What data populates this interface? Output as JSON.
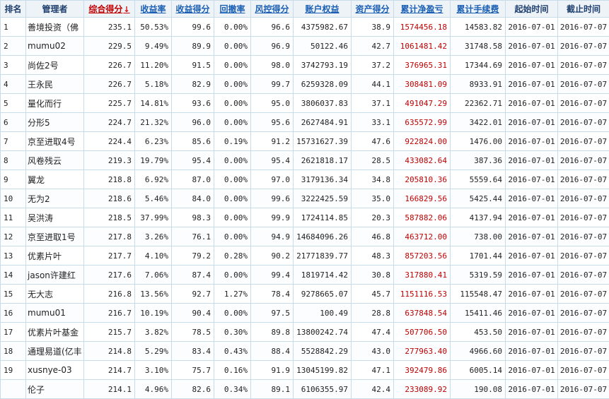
{
  "headers": [
    {
      "label": "排名",
      "sortable": false
    },
    {
      "label": "管理者",
      "sortable": false
    },
    {
      "label": "综合得分",
      "sortable": true,
      "sorted": true,
      "sort_icon": "sort-desc-arrow",
      "sort_glyph": "↓"
    },
    {
      "label": "收益率",
      "sortable": true
    },
    {
      "label": "收益得分",
      "sortable": true
    },
    {
      "label": "回撤率",
      "sortable": true
    },
    {
      "label": "风控得分",
      "sortable": true
    },
    {
      "label": "账户权益",
      "sortable": true
    },
    {
      "label": "资产得分",
      "sortable": true
    },
    {
      "label": "累计净盈亏",
      "sortable": true
    },
    {
      "label": "累计手续费",
      "sortable": true
    },
    {
      "label": "起始时间",
      "sortable": false
    },
    {
      "label": "截止时间",
      "sortable": false
    }
  ],
  "profit_color": "#c00000",
  "rows": [
    [
      "1",
      "善境投资（佛",
      "235.1",
      "50.53%",
      "99.6",
      "0.00%",
      "96.6",
      "4375982.67",
      "38.9",
      "1574456.18",
      "14583.82",
      "2016-07-01",
      "2016-07-07"
    ],
    [
      "2",
      "mumu02",
      "229.5",
      "9.49%",
      "89.9",
      "0.00%",
      "96.9",
      "50122.46",
      "42.7",
      "1061481.42",
      "31748.58",
      "2016-07-01",
      "2016-07-07"
    ],
    [
      "3",
      "尚佐2号",
      "226.7",
      "11.20%",
      "91.5",
      "0.00%",
      "98.0",
      "3742793.19",
      "37.2",
      "376965.31",
      "17344.69",
      "2016-07-01",
      "2016-07-07"
    ],
    [
      "4",
      "王永民",
      "226.7",
      "5.18%",
      "82.9",
      "0.00%",
      "99.7",
      "6259328.09",
      "44.1",
      "308481.09",
      "8933.91",
      "2016-07-01",
      "2016-07-07"
    ],
    [
      "5",
      "量化而行",
      "225.7",
      "14.81%",
      "93.6",
      "0.00%",
      "95.0",
      "3806037.83",
      "37.1",
      "491047.29",
      "22362.71",
      "2016-07-01",
      "2016-07-07"
    ],
    [
      "6",
      "分形5",
      "224.7",
      "21.32%",
      "96.0",
      "0.00%",
      "95.6",
      "2627484.91",
      "33.1",
      "635572.99",
      "3422.01",
      "2016-07-01",
      "2016-07-07"
    ],
    [
      "7",
      "京至进取4号",
      "224.4",
      "6.23%",
      "85.6",
      "0.19%",
      "91.2",
      "15731627.39",
      "47.6",
      "922824.00",
      "1476.00",
      "2016-07-01",
      "2016-07-07"
    ],
    [
      "8",
      "风卷残云",
      "219.3",
      "19.79%",
      "95.4",
      "0.00%",
      "95.4",
      "2621818.17",
      "28.5",
      "433082.64",
      "387.36",
      "2016-07-01",
      "2016-07-07"
    ],
    [
      "9",
      "翼龙",
      "218.8",
      "6.92%",
      "87.0",
      "0.00%",
      "97.0",
      "3179136.34",
      "34.8",
      "205810.36",
      "5559.64",
      "2016-07-01",
      "2016-07-07"
    ],
    [
      "10",
      "无为2",
      "218.6",
      "5.46%",
      "84.0",
      "0.00%",
      "99.6",
      "3222425.59",
      "35.0",
      "166829.56",
      "5425.44",
      "2016-07-01",
      "2016-07-07"
    ],
    [
      "11",
      "吴洪涛",
      "218.5",
      "37.99%",
      "98.3",
      "0.00%",
      "99.9",
      "1724114.85",
      "20.3",
      "587882.06",
      "4137.94",
      "2016-07-01",
      "2016-07-07"
    ],
    [
      "12",
      "京至进取1号",
      "217.8",
      "3.26%",
      "76.1",
      "0.00%",
      "94.9",
      "14684096.26",
      "46.8",
      "463712.00",
      "738.00",
      "2016-07-01",
      "2016-07-07"
    ],
    [
      "13",
      "优素片叶",
      "217.7",
      "4.10%",
      "79.2",
      "0.28%",
      "90.2",
      "21771839.77",
      "48.3",
      "857203.56",
      "1701.44",
      "2016-07-01",
      "2016-07-07"
    ],
    [
      "14",
      "jason许建红",
      "217.6",
      "7.06%",
      "87.4",
      "0.00%",
      "99.4",
      "1819714.42",
      "30.8",
      "317880.41",
      "5319.59",
      "2016-07-01",
      "2016-07-07"
    ],
    [
      "15",
      "无大志",
      "216.8",
      "13.56%",
      "92.7",
      "1.27%",
      "78.4",
      "9278665.07",
      "45.7",
      "1151116.53",
      "115548.47",
      "2016-07-01",
      "2016-07-07"
    ],
    [
      "16",
      "mumu01",
      "216.7",
      "10.19%",
      "90.4",
      "0.00%",
      "97.5",
      "100.49",
      "28.8",
      "637848.54",
      "15411.46",
      "2016-07-01",
      "2016-07-07"
    ],
    [
      "17",
      "优素片叶基金",
      "215.7",
      "3.82%",
      "78.5",
      "0.30%",
      "89.8",
      "13800242.74",
      "47.4",
      "507706.50",
      "453.50",
      "2016-07-01",
      "2016-07-07"
    ],
    [
      "18",
      "通理易道(亿丰",
      "214.8",
      "5.29%",
      "83.4",
      "0.43%",
      "88.4",
      "5528842.29",
      "43.0",
      "277963.40",
      "4966.60",
      "2016-07-01",
      "2016-07-07"
    ],
    [
      "19",
      "xusnye-03",
      "214.7",
      "3.10%",
      "75.7",
      "0.16%",
      "91.9",
      "13045199.82",
      "47.1",
      "392479.86",
      "6005.14",
      "2016-07-01",
      "2016-07-07"
    ],
    [
      "",
      "伦子",
      "214.1",
      "4.96%",
      "82.6",
      "0.34%",
      "89.1",
      "6106355.97",
      "42.4",
      "233089.92",
      "190.08",
      "2016-07-01",
      "2016-07-07"
    ]
  ]
}
